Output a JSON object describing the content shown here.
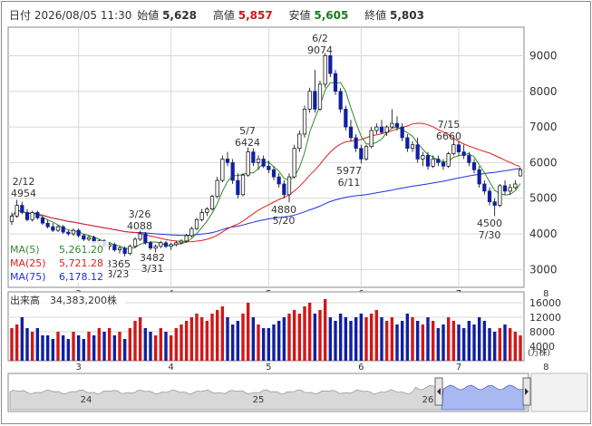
{
  "header": {
    "date_label": "日付",
    "datetime": "2026/08/05 11:30",
    "open_label": "始値",
    "open_value": "5,628",
    "high_label": "高値",
    "high_value": "5,857",
    "low_label": "安値",
    "low_value": "5,605",
    "close_label": "終値",
    "close_value": "5,803"
  },
  "legend": [
    {
      "label": "MA(5)",
      "value": "5,261.20",
      "color": "#2e8b2e"
    },
    {
      "label": "MA(25)",
      "value": "5,721.28",
      "color": "#e02020"
    },
    {
      "label": "MA(75)",
      "value": "6,178.12",
      "color": "#2030e0"
    }
  ],
  "volume_label": "出来高",
  "volume_value": "34,383,200株",
  "volume_unit": "(万株)",
  "colors": {
    "up": "#d01818",
    "down": "#1020a0",
    "frame": "#8a8a8a",
    "grid": "#d8d8d8",
    "navigator_fill": "#a8b8f0"
  },
  "chart_data": [
    {
      "type": "candlestick",
      "x_month_ticks": [
        "3",
        "4",
        "5",
        "6",
        "7",
        "8"
      ],
      "ylim": [
        2500,
        9800
      ],
      "y_ticks": [
        3000,
        4000,
        5000,
        6000,
        7000,
        8000,
        9000
      ],
      "annotations": [
        {
          "date": "2/12",
          "value": "4954"
        },
        {
          "date": "3/26",
          "value": "4088"
        },
        {
          "date": "3/23",
          "value": "3365"
        },
        {
          "date": "3/31",
          "value": "3482"
        },
        {
          "date": "5/7",
          "value": "6424"
        },
        {
          "date": "5/20",
          "value": "4880"
        },
        {
          "date": "6/2",
          "value": "9074"
        },
        {
          "date": "6/11",
          "value": "5977"
        },
        {
          "date": "7/15",
          "value": "6660"
        },
        {
          "date": "7/30",
          "value": "4500"
        }
      ],
      "ohlc": [
        [
          4350,
          4600,
          4250,
          4500
        ],
        [
          4500,
          4954,
          4450,
          4800
        ],
        [
          4800,
          4900,
          4550,
          4600
        ],
        [
          4600,
          4700,
          4350,
          4400
        ],
        [
          4400,
          4650,
          4350,
          4600
        ],
        [
          4600,
          4650,
          4400,
          4450
        ],
        [
          4450,
          4500,
          4250,
          4300
        ],
        [
          4300,
          4400,
          4150,
          4200
        ],
        [
          4200,
          4300,
          4050,
          4100
        ],
        [
          4100,
          4250,
          4050,
          4200
        ],
        [
          4200,
          4250,
          4000,
          4050
        ],
        [
          4050,
          4100,
          3950,
          4000
        ],
        [
          4000,
          4150,
          3950,
          4100
        ],
        [
          4100,
          4150,
          3900,
          3950
        ],
        [
          3950,
          4000,
          3800,
          3850
        ],
        [
          3850,
          3950,
          3750,
          3900
        ],
        [
          3900,
          3950,
          3700,
          3750
        ],
        [
          3750,
          3850,
          3650,
          3800
        ],
        [
          3800,
          3850,
          3600,
          3650
        ],
        [
          3650,
          3750,
          3550,
          3700
        ],
        [
          3700,
          3750,
          3500,
          3550
        ],
        [
          3550,
          3650,
          3450,
          3600
        ],
        [
          3600,
          3650,
          3365,
          3450
        ],
        [
          3450,
          3700,
          3400,
          3650
        ],
        [
          3650,
          3900,
          3600,
          3850
        ],
        [
          3850,
          4088,
          3800,
          4000
        ],
        [
          4000,
          4050,
          3700,
          3750
        ],
        [
          3750,
          3800,
          3550,
          3600
        ],
        [
          3600,
          3700,
          3482,
          3650
        ],
        [
          3650,
          3800,
          3600,
          3750
        ],
        [
          3750,
          3800,
          3600,
          3650
        ],
        [
          3650,
          3750,
          3550,
          3700
        ],
        [
          3700,
          3800,
          3650,
          3750
        ],
        [
          3750,
          3850,
          3700,
          3800
        ],
        [
          3800,
          4000,
          3750,
          3950
        ],
        [
          3950,
          4200,
          3900,
          4150
        ],
        [
          4150,
          4450,
          4100,
          4400
        ],
        [
          4400,
          4700,
          4350,
          4600
        ],
        [
          4600,
          4750,
          4500,
          4700
        ],
        [
          4700,
          5100,
          4650,
          5050
        ],
        [
          5050,
          5600,
          5000,
          5500
        ],
        [
          5500,
          6200,
          5450,
          6100
        ],
        [
          6100,
          6300,
          5900,
          6000
        ],
        [
          6000,
          6100,
          5400,
          5500
        ],
        [
          5500,
          5700,
          5000,
          5100
        ],
        [
          5100,
          5700,
          5050,
          5650
        ],
        [
          5650,
          6424,
          5600,
          6300
        ],
        [
          6300,
          6400,
          5900,
          6000
        ],
        [
          6000,
          6200,
          5800,
          6100
        ],
        [
          6100,
          6200,
          5850,
          5900
        ],
        [
          5900,
          6050,
          5700,
          5800
        ],
        [
          5800,
          5900,
          5500,
          5600
        ],
        [
          5600,
          5700,
          5300,
          5400
        ],
        [
          5400,
          5500,
          5000,
          5100
        ],
        [
          5100,
          5700,
          4880,
          5600
        ],
        [
          5600,
          6500,
          5550,
          6400
        ],
        [
          6400,
          6900,
          6300,
          6800
        ],
        [
          6800,
          7600,
          6700,
          7500
        ],
        [
          7500,
          8100,
          7400,
          8000
        ],
        [
          8000,
          8600,
          7400,
          7500
        ],
        [
          7500,
          8300,
          7450,
          8200
        ],
        [
          8200,
          9074,
          8100,
          9000
        ],
        [
          9000,
          9050,
          8400,
          8500
        ],
        [
          8500,
          8600,
          7900,
          8000
        ],
        [
          8000,
          8100,
          7400,
          7500
        ],
        [
          7500,
          7600,
          6900,
          7000
        ],
        [
          7000,
          7200,
          6600,
          6700
        ],
        [
          6700,
          6800,
          6300,
          6400
        ],
        [
          6400,
          6500,
          5977,
          6100
        ],
        [
          6100,
          6500,
          6050,
          6450
        ],
        [
          6450,
          7000,
          6400,
          6900
        ],
        [
          6900,
          7100,
          6800,
          7000
        ],
        [
          7000,
          7200,
          6800,
          6850
        ],
        [
          6850,
          7050,
          6750,
          7000
        ],
        [
          7000,
          7500,
          6950,
          7100
        ],
        [
          7100,
          7300,
          6900,
          7000
        ],
        [
          7000,
          7100,
          6600,
          6700
        ],
        [
          6700,
          6800,
          6300,
          6400
        ],
        [
          6400,
          6600,
          6300,
          6500
        ],
        [
          6500,
          6700,
          6000,
          6100
        ],
        [
          6100,
          6300,
          5900,
          6200
        ],
        [
          6200,
          6300,
          5800,
          5900
        ],
        [
          5900,
          6200,
          5850,
          6100
        ],
        [
          6100,
          6200,
          5900,
          6000
        ],
        [
          6000,
          6100,
          5800,
          5900
        ],
        [
          5900,
          6300,
          5850,
          6250
        ],
        [
          6250,
          6660,
          6200,
          6500
        ],
        [
          6500,
          6600,
          6200,
          6300
        ],
        [
          6300,
          6500,
          6100,
          6200
        ],
        [
          6200,
          6300,
          5900,
          6000
        ],
        [
          6000,
          6100,
          5700,
          5800
        ],
        [
          5800,
          5900,
          5300,
          5400
        ],
        [
          5400,
          5500,
          5100,
          5200
        ],
        [
          5200,
          5300,
          4800,
          4900
        ],
        [
          4900,
          5000,
          4500,
          4800
        ],
        [
          4800,
          5400,
          4750,
          5350
        ],
        [
          5350,
          5500,
          5100,
          5200
        ],
        [
          5200,
          5400,
          5100,
          5300
        ],
        [
          5300,
          5500,
          5250,
          5400
        ],
        [
          5628,
          5857,
          5605,
          5803
        ]
      ],
      "volume": [
        9,
        10,
        12,
        9,
        8,
        9,
        7,
        7,
        6,
        8,
        7,
        6,
        8,
        7,
        6,
        8,
        7,
        9,
        8,
        9,
        7,
        8,
        6,
        9,
        11,
        12,
        9,
        8,
        7,
        9,
        8,
        7,
        9,
        10,
        11,
        12,
        13,
        12,
        11,
        13,
        14,
        15,
        12,
        10,
        11,
        13,
        16,
        12,
        10,
        9,
        9,
        10,
        11,
        12,
        13,
        14,
        13,
        15,
        16,
        13,
        14,
        17,
        12,
        11,
        13,
        12,
        11,
        12,
        13,
        12,
        13,
        14,
        12,
        11,
        12,
        10,
        11,
        13,
        12,
        11,
        10,
        12,
        11,
        9,
        10,
        12,
        11,
        10,
        9,
        11,
        10,
        12,
        11,
        9,
        8,
        9,
        10,
        9,
        8,
        7
      ],
      "volume_ylim": [
        0,
        19000
      ],
      "volume_ticks": [
        4000,
        8000,
        12000,
        16000
      ],
      "navigator_labels": [
        "24",
        "25",
        "26"
      ]
    }
  ]
}
